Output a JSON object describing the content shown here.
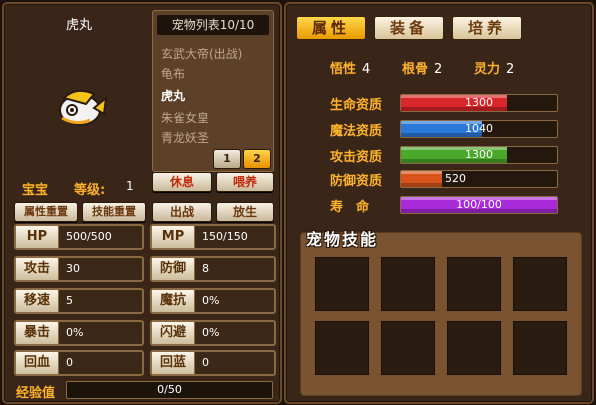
{
  "left": {
    "pet_name": "虎丸",
    "pet_list": {
      "title": "宠物列表10/10",
      "items": [
        "玄武大帝(出战)",
        "龟布",
        "虎丸",
        "朱雀女皇",
        "青龙妖圣"
      ],
      "active_index": 2,
      "pages": [
        "1",
        "2"
      ]
    },
    "baby_label": "宝宝",
    "level_label": "等级:",
    "level_value": "1",
    "buttons": {
      "rest": "休息",
      "feed": "喂养",
      "reset_attr": "属性重置",
      "reset_skill": "技能重置",
      "battle": "出战",
      "release": "放生"
    },
    "stats": [
      {
        "label": "HP",
        "value": "500/500"
      },
      {
        "label": "MP",
        "value": "150/150"
      },
      {
        "label": "攻击",
        "value": "30"
      },
      {
        "label": "防御",
        "value": "8"
      },
      {
        "label": "移速",
        "value": "5"
      },
      {
        "label": "魔抗",
        "value": "0%"
      },
      {
        "label": "暴击",
        "value": "0%"
      },
      {
        "label": "闪避",
        "value": "0%"
      },
      {
        "label": "回血",
        "value": "0"
      },
      {
        "label": "回蓝",
        "value": "0"
      }
    ],
    "exp_label": "经验值",
    "exp_value": "0/50"
  },
  "right": {
    "tabs": [
      "属性",
      "装备",
      "培养"
    ],
    "active_tab": 0,
    "attributes": [
      {
        "label": "悟性",
        "value": "4"
      },
      {
        "label": "根骨",
        "value": "2"
      },
      {
        "label": "灵力",
        "value": "2"
      }
    ],
    "aptitudes": [
      {
        "label": "生命资质",
        "value": "1300",
        "fill": 0.68,
        "color": "#d8262a"
      },
      {
        "label": "魔法资质",
        "value": "1040",
        "fill": 0.52,
        "color": "#2a78d8"
      },
      {
        "label": "攻击资质",
        "value": "1300",
        "fill": 0.68,
        "color": "#4aa82a"
      },
      {
        "label": "防御资质",
        "value": "520",
        "fill": 0.26,
        "color": "#d8541a"
      },
      {
        "label": "寿　命",
        "value": "100/100",
        "fill": 1.0,
        "color": "#a82ad8"
      }
    ],
    "skills_title": "宠物技能",
    "skill_slot_count": 8
  },
  "icons": {
    "avatar": "pet-avatar-icon"
  }
}
